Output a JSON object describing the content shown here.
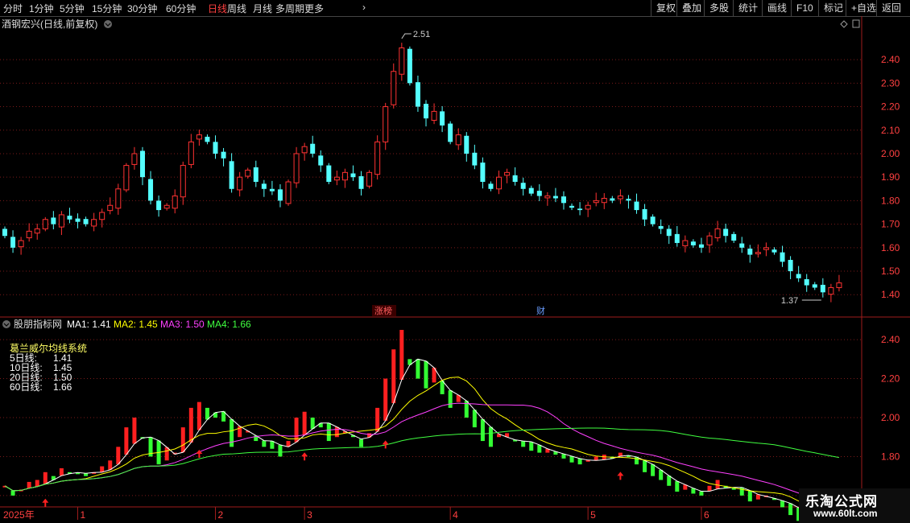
{
  "toolbar": {
    "periods": [
      "分时",
      "1分钟",
      "5分钟",
      "15分钟",
      "30分钟",
      "60分钟",
      "日线",
      "周线",
      "月线",
      "多周期",
      "更多"
    ],
    "active_period": "日线",
    "more_arrow": "›",
    "right_buttons": [
      "复权",
      "叠加",
      "多股",
      "统计",
      "画线",
      "F10",
      "标记",
      "+自选",
      "返回"
    ]
  },
  "stock": {
    "name_label": "酒钢宏兴(日线,前复权)",
    "max_label": "2.51",
    "min_label": "1.37",
    "badge_zhangbang": "涨榜",
    "badge_cai": "财"
  },
  "indicator": {
    "name": "股朋指标网",
    "ma_labels": [
      {
        "text": "MA1: 1.41",
        "color": "#ffffff"
      },
      {
        "text": "MA2: 1.45",
        "color": "#ffff00"
      },
      {
        "text": "MA3: 1.50",
        "color": "#ff40ff"
      },
      {
        "text": "MA4: 1.66",
        "color": "#40ff40"
      }
    ],
    "system_title": "葛兰威尔均线系统",
    "legend_rows": [
      {
        "label": "5日线:",
        "value": "1.41"
      },
      {
        "label": "10日线:",
        "value": "1.45"
      },
      {
        "label": "20日线:",
        "value": "1.50"
      },
      {
        "label": "60日线:",
        "value": "1.66"
      }
    ]
  },
  "x_axis": {
    "year_label": "2025年",
    "month_labels": [
      "1",
      "2",
      "3",
      "4",
      "5",
      "6"
    ]
  },
  "watermark": {
    "title": "乐淘公式网",
    "url": "www.60lt.com"
  },
  "colors": {
    "up": "#ff3232",
    "down": "#54ffff",
    "ind_up": "#ff2020",
    "ind_down": "#33ff33",
    "ma5": "#ffffff",
    "ma10": "#ffff00",
    "ma20": "#ff40ff",
    "ma60": "#40ff40",
    "grid": "#7a1a1a",
    "axis_text": "#ff4040"
  },
  "chart_data": [
    {
      "type": "candlestick",
      "title": "酒钢宏兴(日线,前复权)",
      "ylim": [
        1.37,
        2.51
      ],
      "y_ticks": [
        1.4,
        1.5,
        1.6,
        1.7,
        1.8,
        1.9,
        2.0,
        2.1,
        2.2,
        2.3,
        2.4
      ],
      "ohlc_approx_closes": [
        1.65,
        1.6,
        1.63,
        1.67,
        1.68,
        1.72,
        1.7,
        1.74,
        1.72,
        1.71,
        1.7,
        1.72,
        1.75,
        1.78,
        1.85,
        1.95,
        2.0,
        1.9,
        1.8,
        1.76,
        1.78,
        1.82,
        1.95,
        2.05,
        2.08,
        2.05,
        2.0,
        1.98,
        1.85,
        1.9,
        1.93,
        1.88,
        1.85,
        1.84,
        1.8,
        1.88,
        2.0,
        2.03,
        2.0,
        1.95,
        1.88,
        1.9,
        1.92,
        1.9,
        1.85,
        1.92,
        2.05,
        2.2,
        2.35,
        2.45,
        2.3,
        2.2,
        2.15,
        2.18,
        2.12,
        2.05,
        2.08,
        2.0,
        1.95,
        1.88,
        1.85,
        1.9,
        1.92,
        1.88,
        1.85,
        1.83,
        1.82,
        1.82,
        1.81,
        1.79,
        1.77,
        1.76,
        1.78,
        1.8,
        1.81,
        1.8,
        1.82,
        1.8,
        1.76,
        1.72,
        1.7,
        1.68,
        1.65,
        1.62,
        1.63,
        1.61,
        1.6,
        1.65,
        1.68,
        1.65,
        1.63,
        1.6,
        1.57,
        1.58,
        1.6,
        1.58,
        1.54,
        1.5,
        1.47,
        1.44,
        1.43,
        1.41,
        1.43,
        1.45
      ]
    },
    {
      "type": "line",
      "title": "股朋指标网",
      "ylim": [
        1.55,
        2.45
      ],
      "y_ticks": [
        1.6,
        1.8,
        2.0,
        2.2,
        2.4
      ],
      "series": [
        {
          "name": "MA1",
          "last": 1.41
        },
        {
          "name": "MA2",
          "last": 1.45
        },
        {
          "name": "MA3",
          "last": 1.5
        },
        {
          "name": "MA4",
          "last": 1.66
        }
      ]
    }
  ]
}
